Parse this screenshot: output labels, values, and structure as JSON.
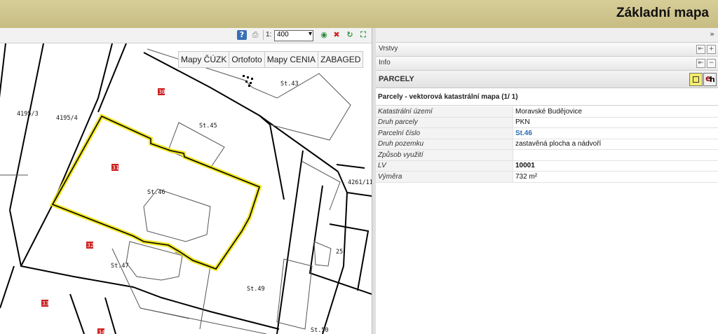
{
  "header": {
    "title": "Základní mapa"
  },
  "toolbar": {
    "scale_prefix": "1:",
    "scale_value": "400",
    "icons": [
      "help-icon",
      "print-icon",
      "globe-icon",
      "close-icon",
      "refresh-icon",
      "fullscreen-icon"
    ]
  },
  "map": {
    "layer_buttons": [
      "Mapy ČÚZK",
      "Ortofoto",
      "Mapy CENIA",
      "ZABAGED"
    ],
    "parcel_numbers": [
      "30",
      "31",
      "32",
      "33",
      "34"
    ],
    "labels": [
      "St.43",
      "4195/3",
      "4195/4",
      "St.45",
      "St.46",
      "4261/11",
      "St.47",
      "25",
      "St.49",
      "St.50"
    ],
    "highlight_color": "#f0e400"
  },
  "panel": {
    "collapse_glyph": "»",
    "sections": [
      "Vrstvy",
      "Info"
    ],
    "parcely_title": "PARCELY",
    "subtitle": "Parcely - vektorová katastrální mapa (1/ 1)",
    "attributes": [
      {
        "key": "Katastrální území",
        "value": "Moravské Budějovice"
      },
      {
        "key": "Druh parcely",
        "value": "PKN"
      },
      {
        "key": "Parcelní číslo",
        "value": "St.46"
      },
      {
        "key": "Druh pozemku",
        "value": "zastavěná plocha a nádvoří"
      },
      {
        "key": "Způsob využití",
        "value": ""
      },
      {
        "key": "LV",
        "value": "10001"
      },
      {
        "key": "Výměra",
        "value": "732 m²"
      }
    ]
  }
}
